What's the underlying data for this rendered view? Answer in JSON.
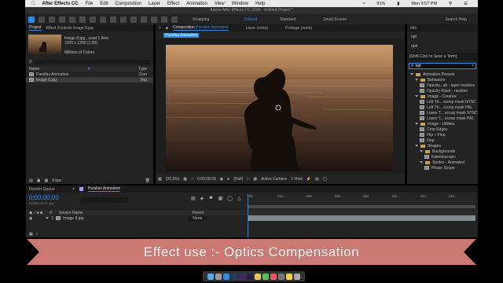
{
  "menubar": {
    "app_name": "After Effects CC",
    "items": [
      "File",
      "Edit",
      "Composition",
      "Layer",
      "Effect",
      "Animation",
      "View",
      "Window",
      "Help"
    ],
    "battery": "91%",
    "clock": "Mon 9:57 PM"
  },
  "window_title": "Adobe After Effects CC 2018 - Untitled Project *",
  "toolbar": {
    "snapping_label": "Snapping",
    "workspaces": [
      "Default",
      "Standard",
      "Small Screen"
    ],
    "search_help_placeholder": "Search Help"
  },
  "project_panel": {
    "tab_project": "Project",
    "tab_effect_controls": "Effect Controls Image 8.jpg",
    "asset_name": "Image 8.jpg , used 1 time",
    "asset_dims": "1920 x 1280 (1.00)",
    "asset_colors": "Millions of Colors",
    "col_name": "Name",
    "col_type": "Type",
    "items": [
      {
        "name": "Parallax Animation",
        "type": "Com"
      },
      {
        "name": "Image 8.jpg",
        "type": "Imp"
      }
    ],
    "bpc": "8 bpc"
  },
  "composition_panel": {
    "tab_composition": "Composition",
    "comp_name": "Parallax Animation",
    "tab_layer": "Layer (none)",
    "tab_footage": "Footage (none)",
    "subtab": "Parallax Animation",
    "zoom": "(33.3%)",
    "timecode": "0;00;00;00",
    "resolution": "(Half)",
    "camera": "Active Camera",
    "views": "1 View"
  },
  "right_panel": {
    "info_tab": "Info",
    "entries": [
      "opt",
      "opti"
    ],
    "save_term": "[Shift-Click to Save a Term]",
    "search_value": "opt",
    "tree": [
      {
        "label": "Animation Presets",
        "level": 0,
        "kind": "folder"
      },
      {
        "label": "Behaviors",
        "level": 1,
        "kind": "folder"
      },
      {
        "label": "Opacity...ah - layer markers",
        "level": 2,
        "kind": "preset"
      },
      {
        "label": "Opacity Flash - random",
        "level": 2,
        "kind": "preset"
      },
      {
        "label": "Image - Creative",
        "level": 1,
        "kind": "folder"
      },
      {
        "label": "Left Th... scoop mask NTSC",
        "level": 2,
        "kind": "preset"
      },
      {
        "label": "Left Th... scoop mask PAL",
        "level": 2,
        "kind": "preset"
      },
      {
        "label": "Lower T... scoop mask NTSC",
        "level": 2,
        "kind": "preset"
      },
      {
        "label": "Lower T... scoop mask PAL",
        "level": 2,
        "kind": "preset"
      },
      {
        "label": "Image - Utilities",
        "level": 1,
        "kind": "folder"
      },
      {
        "label": "Crop Edges",
        "level": 2,
        "kind": "preset"
      },
      {
        "label": "Flip + Flop",
        "level": 2,
        "kind": "preset"
      },
      {
        "label": "Flop",
        "level": 2,
        "kind": "preset"
      },
      {
        "label": "Shapes",
        "level": 1,
        "kind": "folder"
      },
      {
        "label": "Backgrounds",
        "level": 2,
        "kind": "folder"
      },
      {
        "label": "Kaleidoscopic",
        "level": 3,
        "kind": "preset"
      },
      {
        "label": "Sprites - Animated",
        "level": 2,
        "kind": "folder"
      },
      {
        "label": "Phase Scope",
        "level": 3,
        "kind": "preset"
      }
    ]
  },
  "timeline": {
    "tab_render_queue": "Render Queue",
    "tab_comp": "Parallax Animation",
    "timecode": "0;00;00;00",
    "timecode_sub": "00000 (29.97 fps)",
    "col_source_name": "Source Name",
    "col_parent": "Parent",
    "layer_index": "1",
    "layer_name": "Image 8.jpg",
    "layer_parent": "None",
    "ruler_ticks": [
      "0s",
      "02s",
      "04s",
      "06s",
      "08s",
      "10s",
      "12s",
      "14s"
    ]
  },
  "banner": {
    "text": "Effect use :- Optics  Compensation",
    "color": "#c97872"
  },
  "colors": {
    "accent": "#2d8ceb",
    "panel_bg": "#232323",
    "app_icon": "#9999ff"
  }
}
